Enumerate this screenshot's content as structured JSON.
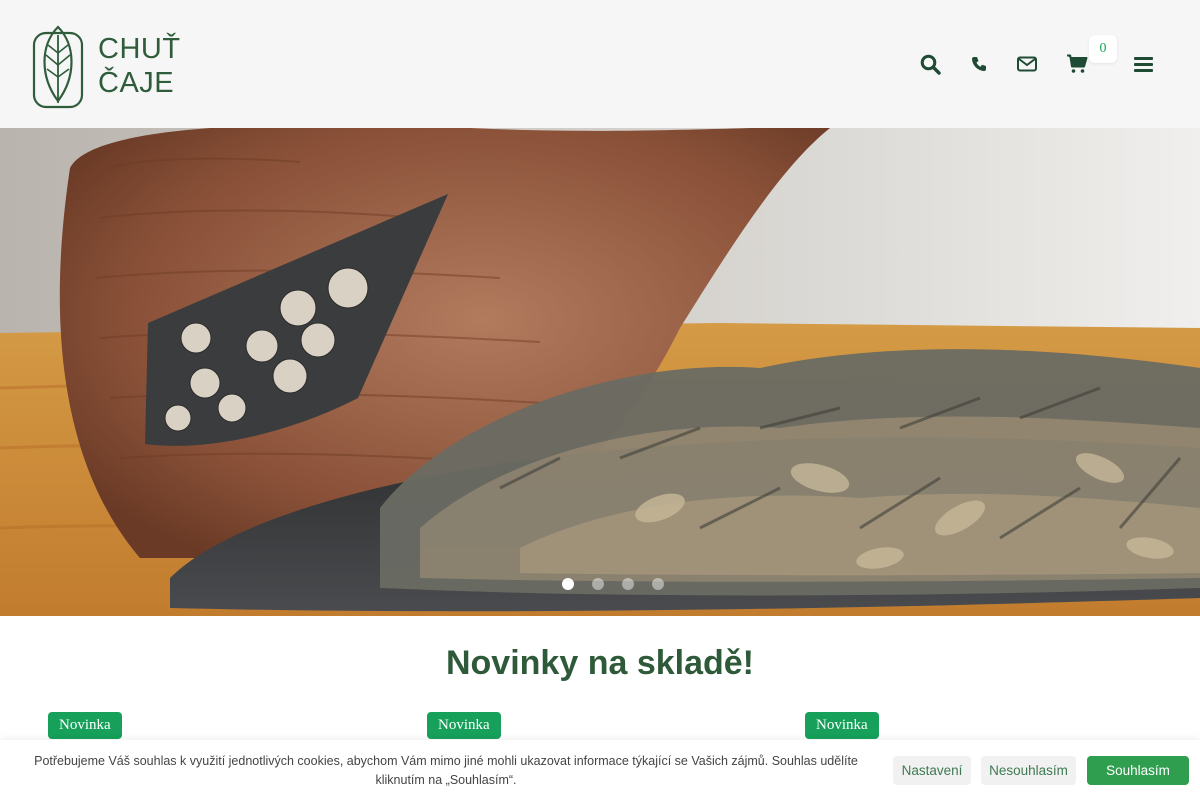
{
  "brand": {
    "line1": "CHUŤ",
    "line2": "ČAJE",
    "color": "#2f5d3c"
  },
  "header": {
    "icons": [
      "search-icon",
      "phone-icon",
      "envelope-icon",
      "cart-icon",
      "menu-icon"
    ],
    "cart_count": "0"
  },
  "hero": {
    "slide_count": 4,
    "active_slide": 1
  },
  "section": {
    "title": "Novinky na skladě!"
  },
  "products": [
    {
      "badge": "Novinka"
    },
    {
      "badge": "Novinka"
    },
    {
      "badge": "Novinka"
    }
  ],
  "cookie": {
    "text": "Potřebujeme Váš souhlas k využití jednotlivých cookies, abychom Vám mimo jiné mohli ukazovat informace týkající se Vašich zájmů. Souhlas udělíte kliknutím na „Souhlasím“.",
    "settings_label": "Nastavení",
    "decline_label": "Nesouhlasím",
    "accept_label": "Souhlasím"
  },
  "colors": {
    "accent": "#16a05a",
    "title": "#2e5a3a",
    "header_bg": "#f6f6f6"
  }
}
